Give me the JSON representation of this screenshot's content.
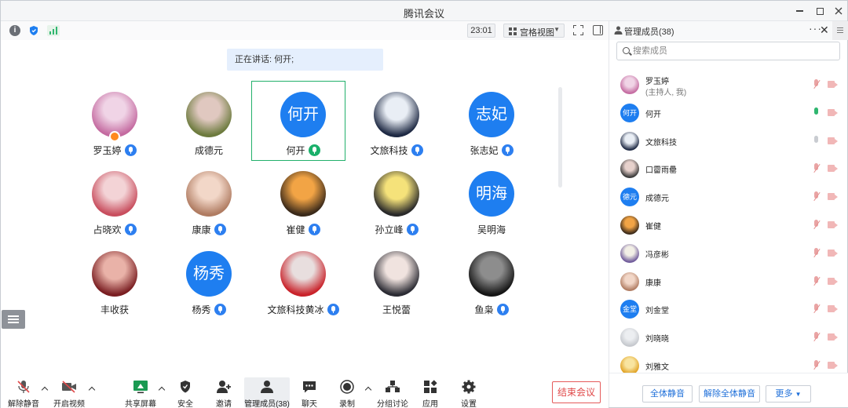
{
  "window": {
    "title": "腾讯会议"
  },
  "toolbar": {
    "timer": "23:01",
    "view_mode": "宫格视图"
  },
  "speaking": {
    "text": "正在讲话: 何开;"
  },
  "grid": {
    "tiles": [
      {
        "name": "罗玉婷",
        "avatar": "photo",
        "colors": [
          "#c46aa0",
          "#f0d4e6"
        ],
        "mic": "on",
        "host": true
      },
      {
        "name": "成德元",
        "avatar": "photo",
        "colors": [
          "#6d7b3e",
          "#e0c8c0"
        ],
        "mic": "none"
      },
      {
        "name": "何开",
        "avatar": "text",
        "avatar_text": "何开",
        "mic": "speaking",
        "highlight": true
      },
      {
        "name": "文旅科技",
        "avatar": "photo",
        "colors": [
          "#1f2a44",
          "#e9eef5"
        ],
        "mic": "on"
      },
      {
        "name": "张志妃",
        "avatar": "text",
        "avatar_text": "志妃",
        "mic": "on"
      },
      {
        "name": "占晓欢",
        "avatar": "photo",
        "colors": [
          "#c84e5e",
          "#f3d3d6"
        ],
        "mic": "on"
      },
      {
        "name": "康康",
        "avatar": "photo",
        "colors": [
          "#b07c62",
          "#f2d7c8"
        ],
        "mic": "on"
      },
      {
        "name": "崔健",
        "avatar": "photo",
        "colors": [
          "#3b2a1a",
          "#f2a445"
        ],
        "mic": "on"
      },
      {
        "name": "孙立峰",
        "avatar": "photo",
        "colors": [
          "#2a2a2a",
          "#f5e27a"
        ],
        "mic": "on"
      },
      {
        "name": "吴明海",
        "avatar": "text",
        "avatar_text": "明海",
        "mic": "none"
      },
      {
        "name": "丰收获",
        "avatar": "photo",
        "colors": [
          "#7a1e22",
          "#e9b2a8"
        ],
        "mic": "none"
      },
      {
        "name": "杨秀",
        "avatar": "text",
        "avatar_text": "杨秀",
        "mic": "on"
      },
      {
        "name": "文旅科技黄冰",
        "avatar": "photo",
        "colors": [
          "#c9232b",
          "#e8dede"
        ],
        "mic": "on"
      },
      {
        "name": "王悦蕾",
        "avatar": "photo",
        "colors": [
          "#2c2c34",
          "#f0e3df"
        ],
        "mic": "none"
      },
      {
        "name": "鱼枭",
        "avatar": "photo",
        "colors": [
          "#161616",
          "#8d8d8d"
        ],
        "mic": "on"
      }
    ]
  },
  "bottombar": {
    "unmute": "解除静音",
    "start_video": "开启视频",
    "share_screen": "共享屏幕",
    "security": "安全",
    "invite": "邀请",
    "manage_members": "管理成员(38)",
    "chat": "聊天",
    "record": "录制",
    "breakout": "分组讨论",
    "apps": "应用",
    "settings": "设置",
    "end_meeting": "结束会议"
  },
  "panel": {
    "title": "管理成员(38)",
    "search_placeholder": "搜索成员",
    "members": [
      {
        "name": "罗玉婷",
        "sub": "(主持人, 我)",
        "avatar": "photo",
        "colors": [
          "#c46aa0",
          "#f0d4e6"
        ],
        "mic": "off"
      },
      {
        "name": "何开",
        "avatar": "text",
        "avatar_text": "何开",
        "mic": "on"
      },
      {
        "name": "文旅科技",
        "avatar": "photo",
        "colors": [
          "#1f2a44",
          "#e9eef5"
        ],
        "mic": "idle"
      },
      {
        "name": "口霤雨罍",
        "avatar": "photo",
        "colors": [
          "#3a3a3a",
          "#e7d1cc"
        ],
        "mic": "off"
      },
      {
        "name": "成德元",
        "avatar": "text",
        "avatar_text": "德元",
        "mic": "off"
      },
      {
        "name": "崔健",
        "avatar": "photo",
        "colors": [
          "#3b2a1a",
          "#f2a445"
        ],
        "mic": "off"
      },
      {
        "name": "冯彦彬",
        "avatar": "photo",
        "colors": [
          "#6f5a9a",
          "#f2efe6"
        ],
        "mic": "off"
      },
      {
        "name": "康康",
        "avatar": "photo",
        "colors": [
          "#b07c62",
          "#f2d7c8"
        ],
        "mic": "off"
      },
      {
        "name": "刘金堂",
        "avatar": "text",
        "avatar_text": "金堂",
        "mic": "off"
      },
      {
        "name": "刘晓晓",
        "avatar": "placeholder",
        "colors": [
          "#c5c8cd",
          "#eceef1"
        ],
        "mic": "off"
      },
      {
        "name": "刘雅文",
        "avatar": "photo",
        "colors": [
          "#e0a020",
          "#f8e4a0"
        ],
        "mic": "off"
      }
    ],
    "mute_all": "全体静音",
    "unmute_all": "解除全体静音",
    "more": "更多"
  },
  "colors": {
    "accent": "#1e7ef0",
    "speaking": "#22b06b",
    "danger": "#e04848"
  }
}
